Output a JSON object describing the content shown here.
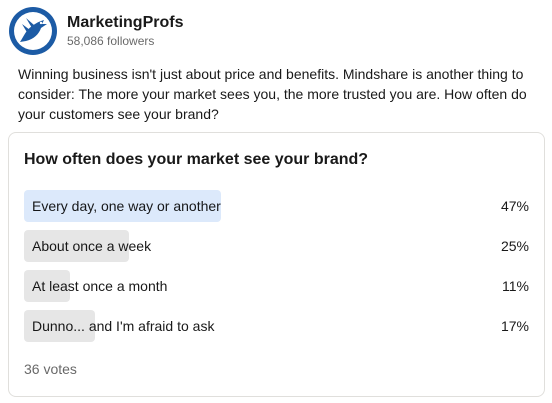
{
  "author": {
    "name": "MarketingProfs",
    "followers": "58,086 followers",
    "avatar_icon": "bird-logo-icon",
    "brand_color": "#1c5ba5"
  },
  "post": {
    "text": "Winning business isn't just about price and benefits. Mindshare is another thing to consider: The more your market sees you, the more trusted you are. How often do your customers see your brand?"
  },
  "poll": {
    "question": "How often does your market see your brand?",
    "options": [
      {
        "label": "Every day, one way or another",
        "percent": "47%",
        "value": 47,
        "leading": true
      },
      {
        "label": "About once a week",
        "percent": "25%",
        "value": 25,
        "leading": false
      },
      {
        "label": "At least once a month",
        "percent": "11%",
        "value": 11,
        "leading": false
      },
      {
        "label": "Dunno... and I'm afraid to ask",
        "percent": "17%",
        "value": 17,
        "leading": false
      }
    ],
    "votes": "36 votes",
    "colors": {
      "leader_bar": "#dce9fb",
      "other_bar": "#e6e6e6"
    }
  }
}
